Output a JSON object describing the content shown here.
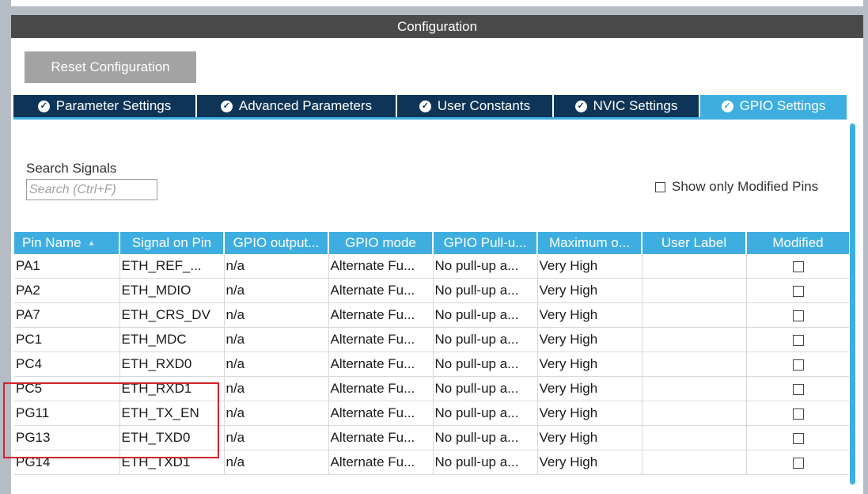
{
  "header": {
    "title": "Configuration"
  },
  "reset_button": "Reset Configuration",
  "tabs": [
    {
      "label": "Parameter Settings",
      "icon": "check-circle-icon",
      "active": false
    },
    {
      "label": "Advanced Parameters",
      "icon": "check-circle-icon",
      "active": false
    },
    {
      "label": "User Constants",
      "icon": "check-circle-icon",
      "active": false
    },
    {
      "label": "NVIC Settings",
      "icon": "check-circle-icon",
      "active": false
    },
    {
      "label": "GPIO Settings",
      "icon": "check-circle-icon",
      "active": true
    }
  ],
  "search": {
    "title": "Search Signals",
    "placeholder": "Search (Ctrl+F)",
    "value": ""
  },
  "show_modified": {
    "label": "Show only Modified Pins",
    "checked": false
  },
  "table": {
    "columns": [
      "Pin Name",
      "Signal on Pin",
      "GPIO output...",
      "GPIO mode",
      "GPIO Pull-u...",
      "Maximum o...",
      "User Label",
      "Modified"
    ],
    "sort_icon": "sort-up-icon",
    "rows": [
      {
        "pin": "PA1",
        "signal": "ETH_REF_...",
        "output": "n/a",
        "mode": "Alternate Fu...",
        "pull": "No pull-up a...",
        "speed": "Very High",
        "label": "",
        "modified": false
      },
      {
        "pin": "PA2",
        "signal": "ETH_MDIO",
        "output": "n/a",
        "mode": "Alternate Fu...",
        "pull": "No pull-up a...",
        "speed": "Very High",
        "label": "",
        "modified": false
      },
      {
        "pin": "PA7",
        "signal": "ETH_CRS_DV",
        "output": "n/a",
        "mode": "Alternate Fu...",
        "pull": "No pull-up a...",
        "speed": "Very High",
        "label": "",
        "modified": false
      },
      {
        "pin": "PC1",
        "signal": "ETH_MDC",
        "output": "n/a",
        "mode": "Alternate Fu...",
        "pull": "No pull-up a...",
        "speed": "Very High",
        "label": "",
        "modified": false
      },
      {
        "pin": "PC4",
        "signal": "ETH_RXD0",
        "output": "n/a",
        "mode": "Alternate Fu...",
        "pull": "No pull-up a...",
        "speed": "Very High",
        "label": "",
        "modified": false
      },
      {
        "pin": "PC5",
        "signal": "ETH_RXD1",
        "output": "n/a",
        "mode": "Alternate Fu...",
        "pull": "No pull-up a...",
        "speed": "Very High",
        "label": "",
        "modified": false
      },
      {
        "pin": "PG11",
        "signal": "ETH_TX_EN",
        "output": "n/a",
        "mode": "Alternate Fu...",
        "pull": "No pull-up a...",
        "speed": "Very High",
        "label": "",
        "modified": false
      },
      {
        "pin": "PG13",
        "signal": "ETH_TXD0",
        "output": "n/a",
        "mode": "Alternate Fu...",
        "pull": "No pull-up a...",
        "speed": "Very High",
        "label": "",
        "modified": false
      },
      {
        "pin": "PG14",
        "signal": "ETH_TXD1",
        "output": "n/a",
        "mode": "Alternate Fu...",
        "pull": "No pull-up a...",
        "speed": "Very High",
        "label": "",
        "modified": false
      }
    ]
  },
  "colors": {
    "header_bg": "#4a4a4a",
    "tab_bg": "#0e3457",
    "accent": "#3eaee0",
    "button_bg": "#a3a3a3",
    "highlight": "#d4212b"
  }
}
